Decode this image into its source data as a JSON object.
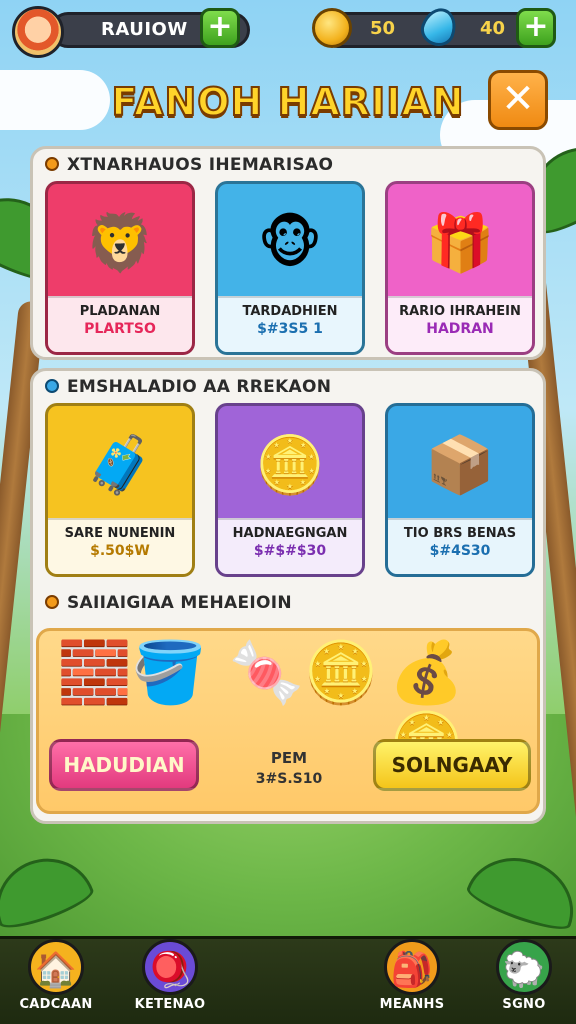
{
  "topbar": {
    "player_name": "RAUIOW",
    "coins": "50",
    "gems": "40",
    "add_label": "+"
  },
  "title": "FANOH HARIIAN",
  "close_label": "✕",
  "section1": {
    "title": "XTNARHAUOS IHEMARISAO",
    "cards": [
      {
        "l1": "PLADANAN",
        "l2": "PLARTSO",
        "l2_color": "#e6275a",
        "bg": "#ee3d6a",
        "icon": "🦁"
      },
      {
        "l1": "TARDADHIEN",
        "l2": "$#3S5 1",
        "l2_color": "#1b6fb0",
        "bg": "#43b3e8",
        "icon": "🐵"
      },
      {
        "l1": "RARIO IHRAHEIN",
        "l2": "HADRAN",
        "l2_color": "#9a2bb5",
        "bg": "#ef62c8",
        "icon": "🎁"
      }
    ]
  },
  "section2": {
    "title": "EMSHALADIO AA RREKAON",
    "cards": [
      {
        "l1": "SARE NUNENIN",
        "l2": "$.50$W",
        "l2_color": "#b57a00",
        "bg": "#f6c320",
        "icon": "🧳"
      },
      {
        "l1": "HADNAEGNGAN",
        "l2": "$#$#$30",
        "l2_color": "#7b2fb0",
        "bg": "#a064d8",
        "icon": "🪙"
      },
      {
        "l1": "TIO BRS BENAS",
        "l2": "$#4S30",
        "l2_color": "#1b6fb0",
        "bg": "#3aa8e6",
        "icon": "📦"
      }
    ]
  },
  "section3": {
    "title": "SAIIAIGIAA MEHAEIOIN",
    "left_button": "HADUDIAN",
    "mid_top": "PEM",
    "mid_bottom": "3#S.S10",
    "right_button": "SOLNGAAY"
  },
  "nav": [
    {
      "label": "CADCAAN",
      "icon": "🏠",
      "bg": "#f5b21e"
    },
    {
      "label": "KETENAO",
      "icon": "🪀",
      "bg": "#6a4bd6"
    },
    {
      "label": "MEANHS",
      "icon": "🎒",
      "bg": "#f19b1b"
    },
    {
      "label": "SGNO",
      "icon": "🐑",
      "bg": "#37a34a"
    }
  ]
}
